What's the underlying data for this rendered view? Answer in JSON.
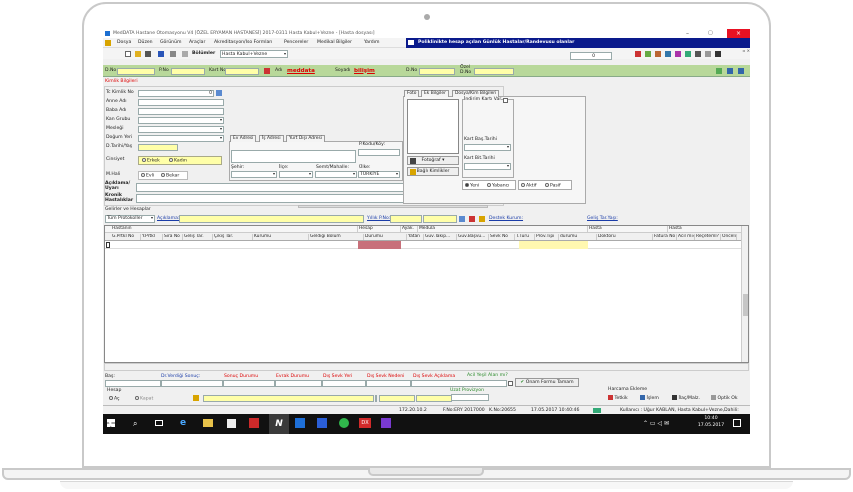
{
  "title": "MedDATA Hastane Otomasyonu V4 [ÖZEL ERYAMAN HASTANESİ] 2017-0311 Hasta Kabul+Vezne - [Hasta dosyası]",
  "menu": [
    "Dosya",
    "Düzen",
    "Görünüm",
    "Araçlar",
    "Akreditasyon/Iso Formları",
    "Pencereler",
    "Medikal Bilgiler",
    "Yardım"
  ],
  "banner": "Poliklinikte hesap açılan Günlük Hastalar/Randevusu olanlar",
  "toolbar": {
    "bolumler_label": "Bölümler",
    "bolumler_value": "Hasta Kabul+Vezne",
    "count": "0"
  },
  "ids": {
    "dno": "D.No",
    "pno": "P.No",
    "kartno": "Kart No",
    "adi": "Adı",
    "adi_val": "meddata",
    "soyadi": "Soyadı",
    "soyadi_val": "bilişim",
    "dno2": "D.No",
    "ozel": "Özel",
    "ozel2": "D.No"
  },
  "kimlik": {
    "title": "Kimlik Bilgileri",
    "tc": "Tc Kimlik No",
    "tc_val": "0",
    "anne": "Anne Adı",
    "baba": "Baba Adı",
    "kan": "Kan Grubu",
    "meslek": "Mesleği",
    "dogum": "Doğum Yeri",
    "dtarihi": "D.Tarihi/Yaş",
    "cinsiyet": "Cinsiyet",
    "erkek": "Erkek",
    "kadin": "Kadın",
    "mhali": "M.Hali",
    "evli": "Evli",
    "bekar": "Bekar",
    "aciklama": "Açıklama/ Uyarı",
    "kronik": "Kronik Hastalıklar"
  },
  "adres": {
    "tabs": [
      "Ev Adresi",
      "İş Adresi",
      "Yurt Dışı Adresi"
    ],
    "pkodu": "P.Kodu/Köy:",
    "sehir": "Şehir:",
    "ilce": "İlçe:",
    "semt": "Semt/Mahalle:",
    "ulke": "Ülke:",
    "ulke_val": "TÜRKİYE"
  },
  "foto": {
    "tabs": [
      "Foto",
      "Ek Bilgiler",
      "Dosya/Kim Bilgileri"
    ],
    "indirim": "İndirim Kartı Var",
    "fotograf": "Fotoğraf",
    "bagli": "Bağlı Kimlikler",
    "kartbas": "Kart Baş.Tarihi",
    "kartbit": "Kart Bit.Tarihi",
    "yeni": "Yeni",
    "yabanci": "Yabancı",
    "aktif": "Aktif",
    "pasif": "Pasif"
  },
  "gelir": {
    "title": "Gelirler ve Hesaplar",
    "protokol": "Tüm Protokoller",
    "aciklama": "Açıklama:",
    "yillik": "Yıllık P.No:",
    "destek": "Destek Kurum:",
    "gelis": "Geliş Tar.Yaşı:"
  },
  "table": {
    "groups": [
      "Hastanın",
      "Hesap",
      "Ayak.",
      "Medula",
      "Hasta",
      "Hasta"
    ],
    "columns": [
      "G.Prtkl No",
      "Y.Prtkl",
      "Sıra No",
      "Geliş Tar.",
      "Çıkış Tar.",
      "Kurumu",
      "Geldiği Bölüm",
      "Durumu",
      "Yatan",
      "Güv.Takip...",
      "Güv.Başvu...",
      "Sevk No",
      "T.Türü",
      "Prov.Tipi",
      "durumu",
      "Doktoru",
      "Fatura No",
      "Acil mi?",
      "Reçeteml?",
      "Öncelikli..."
    ]
  },
  "bottom": {
    "bas": "Baş:",
    "dr": "Dr.Verdiği Sonuç:",
    "sonuc": "Sonuç Durumu",
    "evrak": "Evrak Durumu",
    "sevkyeri": "Dış Sevk Yeri",
    "sevknedeni": "Dış Sevk Nedeni",
    "sevkaciklama": "Dış Sevk Açıklama",
    "acil": "Acil Yeşil Alan mı?",
    "onam": "Onam Formu Tamam",
    "hesap": "Hesap",
    "ac": "Aç",
    "kapat": "Kapat",
    "uzay": "Uzat Provizyon",
    "harcama": "Harcama Ekleme",
    "tetkik": "Tetkik",
    "islem": "İşlem",
    "ilac": "İlaç/Malz.",
    "optik": "Optik Ok"
  },
  "status": {
    "ip": "172.20.10.2",
    "fno": "F.No:ERY 2017000",
    "kno": "K.No:20655",
    "dt": "17.05.2017 10:40:46",
    "user": "Kullanıcı : Uğur KABLAN, Hasta Kabul+Vezne,Dahili:"
  },
  "taskbar": {
    "time": "10:40",
    "date": "17.05.2017"
  }
}
